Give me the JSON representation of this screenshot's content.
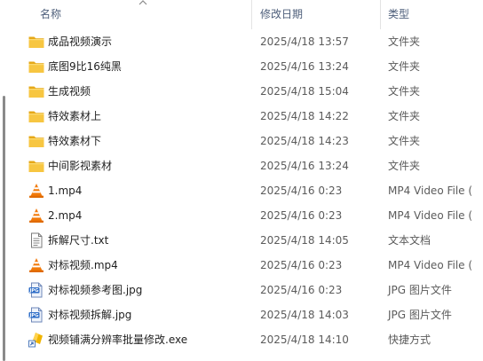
{
  "header": {
    "name_label": "名称",
    "date_label": "修改日期",
    "type_label": "类型"
  },
  "files": [
    {
      "name": "成品视频演示",
      "date": "2025/4/18 13:57",
      "type": "文件夹",
      "icon": "folder-icon"
    },
    {
      "name": "底图9比16纯黑",
      "date": "2025/4/16 13:24",
      "type": "文件夹",
      "icon": "folder-icon"
    },
    {
      "name": "生成视频",
      "date": "2025/4/18 15:04",
      "type": "文件夹",
      "icon": "folder-icon"
    },
    {
      "name": "特效素材上",
      "date": "2025/4/18 14:22",
      "type": "文件夹",
      "icon": "folder-icon"
    },
    {
      "name": "特效素材下",
      "date": "2025/4/18 14:23",
      "type": "文件夹",
      "icon": "folder-icon"
    },
    {
      "name": "中间影视素材",
      "date": "2025/4/16 13:24",
      "type": "文件夹",
      "icon": "folder-icon"
    },
    {
      "name": "1.mp4",
      "date": "2025/4/16 0:23",
      "type": "MP4 Video File (",
      "icon": "vlc-cone-icon"
    },
    {
      "name": "2.mp4",
      "date": "2025/4/16 0:23",
      "type": "MP4 Video File (",
      "icon": "vlc-cone-icon"
    },
    {
      "name": "拆解尺寸.txt",
      "date": "2025/4/18 14:05",
      "type": "文本文档",
      "icon": "text-file-icon"
    },
    {
      "name": "对标视频.mp4",
      "date": "2025/4/16 0:23",
      "type": "MP4 Video File (",
      "icon": "vlc-cone-icon"
    },
    {
      "name": "对标视频参考图.jpg",
      "date": "2025/4/16 0:23",
      "type": "JPG 图片文件",
      "icon": "jpg-image-icon"
    },
    {
      "name": "对标视频拆解.jpg",
      "date": "2025/4/18 14:03",
      "type": "JPG 图片文件",
      "icon": "jpg-image-icon"
    },
    {
      "name": "视频铺满分辨率批量修改.exe",
      "date": "2025/4/18 14:10",
      "type": "快捷方式",
      "icon": "shortcut-exe-icon"
    }
  ],
  "colors": {
    "folder": "#f4c02c",
    "vlc_orange": "#f27a0a",
    "header_text": "#4d5e7a",
    "secondary_text": "#5b5b5b"
  }
}
